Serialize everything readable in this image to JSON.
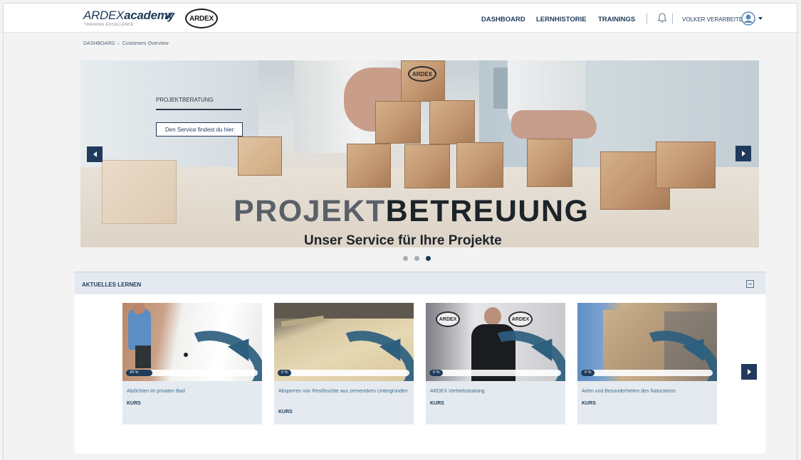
{
  "header": {
    "academy_logo_brand": "ARDEX",
    "academy_logo_suffix": "academy",
    "academy_logo_tagline": "TRAINING EXCELLENCE",
    "brand_logo": "ARDEX",
    "nav": [
      {
        "label": "DASHBOARD"
      },
      {
        "label": "LERNHISTORIE"
      },
      {
        "label": "TRAININGS"
      }
    ],
    "bell_icon": "bell-icon",
    "user_name": "VOLKER VERARBEITER",
    "user_icon": "user-avatar-icon"
  },
  "breadcrumb": {
    "home": "DASHBOARD",
    "separator": "›",
    "current": "Customers Overview"
  },
  "hero": {
    "panel_title": "PROJEKTBERATUNG",
    "cta_label": "Den Service findest du hier:",
    "headline_light": "PROJEKT",
    "headline_bold": "BETREUUNG",
    "subline": "Unser Service für Ihre Projekte",
    "block_logo": "ARDEX",
    "slide_count": 3,
    "active_slide": 3
  },
  "learning": {
    "title": "AKTUELLES LERNEN",
    "cards": [
      {
        "progress_label": "20 %",
        "progress": 0.2,
        "title": "Abdichten im privaten Bad",
        "type": "KURS"
      },
      {
        "progress_label": "0 %",
        "progress": 0.0,
        "title": "Absperren von Restfeuchte aus zementären Untergründen",
        "type": "KURS"
      },
      {
        "progress_label": "0 %",
        "progress": 0.0,
        "title": "ARDEX Vertriebstraining",
        "type": "KURS"
      },
      {
        "progress_label": "0 %",
        "progress": 0.0,
        "title": "Arten und Besonderheiten des Natursteins",
        "type": "KURS"
      }
    ],
    "card_thumb_logo": "ARDEX"
  },
  "colors": {
    "brand_navy": "#1f3a5a",
    "section_bg": "#e4eaef",
    "accent_teal": "#2d5f7f"
  }
}
